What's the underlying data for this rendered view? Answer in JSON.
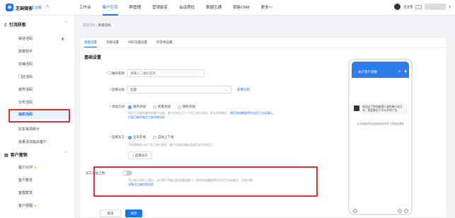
{
  "topbar": {
    "brand": "芝麻微客",
    "edition": "企业版",
    "nav": [
      "工作台",
      "客户引流",
      "群管理",
      "营销裂变",
      "会话质检",
      "数据互通",
      "销售CRM",
      "更多～"
    ],
    "active_nav": "客户引流",
    "user_name": "企业名"
  },
  "sidebar": {
    "groups": [
      {
        "title": "引流获客",
        "items": [
          "渠道活码",
          "获客助手",
          "店铺活码",
          "门店活码",
          "城市活码",
          "分布活码",
          "抽奖活码",
          "好友来源统计",
          "批量添加指派客户"
        ]
      },
      {
        "title": "客户营销",
        "items": [
          "客户SOP",
          "客户群发",
          "客群群发",
          "客户朋圈"
        ]
      }
    ],
    "active_item": "抽奖活码"
  },
  "breadcrumb": {
    "parent": "渠道活码",
    "separator": "/",
    "current": "新建活码"
  },
  "tabs": [
    "基础设置",
    "功能设置",
    "扫码页面设置",
    "欢迎语设置"
  ],
  "form": {
    "section_title": "基础设置",
    "qrcode_name": {
      "label": "二维码名称:",
      "placeholder": "请输入二维码名称"
    },
    "group": {
      "label": "选择分组:",
      "value": "全部",
      "new_group_link": "新增分组"
    },
    "add_mode": {
      "label": "添加方式:",
      "options": [
        "顺序添加",
        "权重添加",
        "随机添加"
      ],
      "selected": 0,
      "desc_line1": "按员工添加的顺序给客户分配，客户扫码后下一个员工则可添加，依次轮询循环。",
      "desc_link": "使用添加额度将开启员工自动通过，",
      "desc_line2": "后面可能导致员工被封禁风险"
    },
    "staff": {
      "label": "选择员工:",
      "options": [
        "全天在线",
        "自动上下线"
      ],
      "selected": 0,
      "desc": "可选择最多100个员工进行使用，客户扫码后随机添加可选中的员工",
      "add_button": "+ 选择员工"
    },
    "daily_limit": {
      "label": "员工添加上限:",
      "desc_line1": "员工每日添加上限后，当日将不再被分配该渠道客户，使用添加额度将开启员工自动通过，后面可能",
      "desc_line2": "导致员工被封禁风险"
    }
  },
  "footer": {
    "cancel": "取消",
    "save": "保存"
  },
  "preview": {
    "title": "关于客户洞察",
    "bubble": "欢迎过了你的新客人请先做入驻正式，我会推出下方公开的广告",
    "notice": "点击添加好友后您将收到该员工的欢迎消息"
  }
}
